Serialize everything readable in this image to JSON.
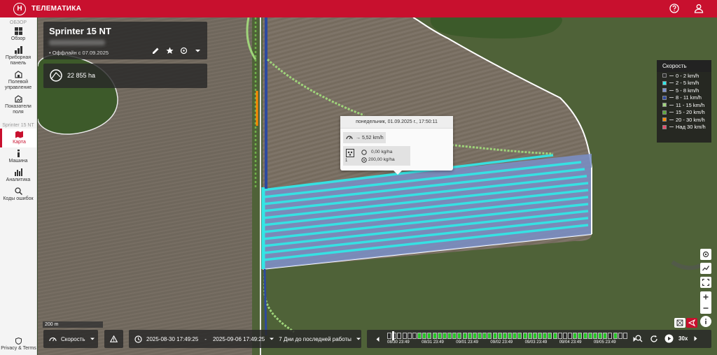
{
  "app": {
    "title": "ТЕЛЕМАТИКА",
    "logo_letter": "H"
  },
  "sidebar": {
    "section_overview": "ОБЗОР",
    "items_top": [
      {
        "label": "Обзор",
        "icon": "grid-icon"
      },
      {
        "label": "Приборная панель",
        "icon": "dashboard-icon"
      },
      {
        "label": "Полевой управление",
        "icon": "field-icon"
      },
      {
        "label": "Показатели поля",
        "icon": "field-stats-icon"
      }
    ],
    "section_machine": "Sprinter 15 NT",
    "items_machine": [
      {
        "label": "Карта",
        "icon": "map-icon",
        "active": true
      },
      {
        "label": "Машина",
        "icon": "info-icon"
      },
      {
        "label": "Аналитика",
        "icon": "chart-icon"
      },
      {
        "label": "Коды ошибок",
        "icon": "error-search-icon"
      }
    ],
    "privacy": "Privacy & Terms"
  },
  "machine": {
    "name": "Sprinter 15 NT",
    "status": "Оффлайн с 07.09.2025",
    "area": "22 855 ha"
  },
  "tooltip": {
    "datetime": "понедельник, 01.09.2025 г., 17:50:11",
    "speed": "→ 5,52 km/h",
    "rate_index": "1",
    "rate_actual": "0,00  kg/ha",
    "rate_target": "200,00 kg/ha"
  },
  "legend": {
    "title": "Скорость",
    "items": [
      {
        "label": "0 - 2 km/h",
        "color": "#2b2b2b"
      },
      {
        "label": "2 - 5 km/h",
        "color": "#2ee6e6"
      },
      {
        "label": "5 - 8 km/h",
        "color": "#7d8fd0"
      },
      {
        "label": "8 - 11 km/h",
        "color": "#2e4a9e"
      },
      {
        "label": "11 - 15 km/h",
        "color": "#9fd47a"
      },
      {
        "label": "15 - 20 km/h",
        "color": "#5aa83a"
      },
      {
        "label": "20 - 30 km/h",
        "color": "#ff8a00"
      },
      {
        "label": "Над 30 km/h",
        "color": "#e84b6a"
      }
    ]
  },
  "scale": {
    "label": "200 m"
  },
  "controls": {
    "speed_select": "Скорость",
    "date_from": "2025-08-30 17:49:25",
    "date_sep": "-",
    "date_to": "2025-09-06 17:49:25",
    "range_select": "7 Дни до последней работы",
    "playback_speed": "30x"
  },
  "timeline": {
    "ticks": [
      "08/30 23:49",
      "08/31 23:49",
      "09/01 23:49",
      "09/02 23:49",
      "09/03 23:49",
      "09/04 23:49",
      "09/05 23:49"
    ]
  },
  "colors": {
    "brand": "#c8102e",
    "activity": "#27c427"
  }
}
